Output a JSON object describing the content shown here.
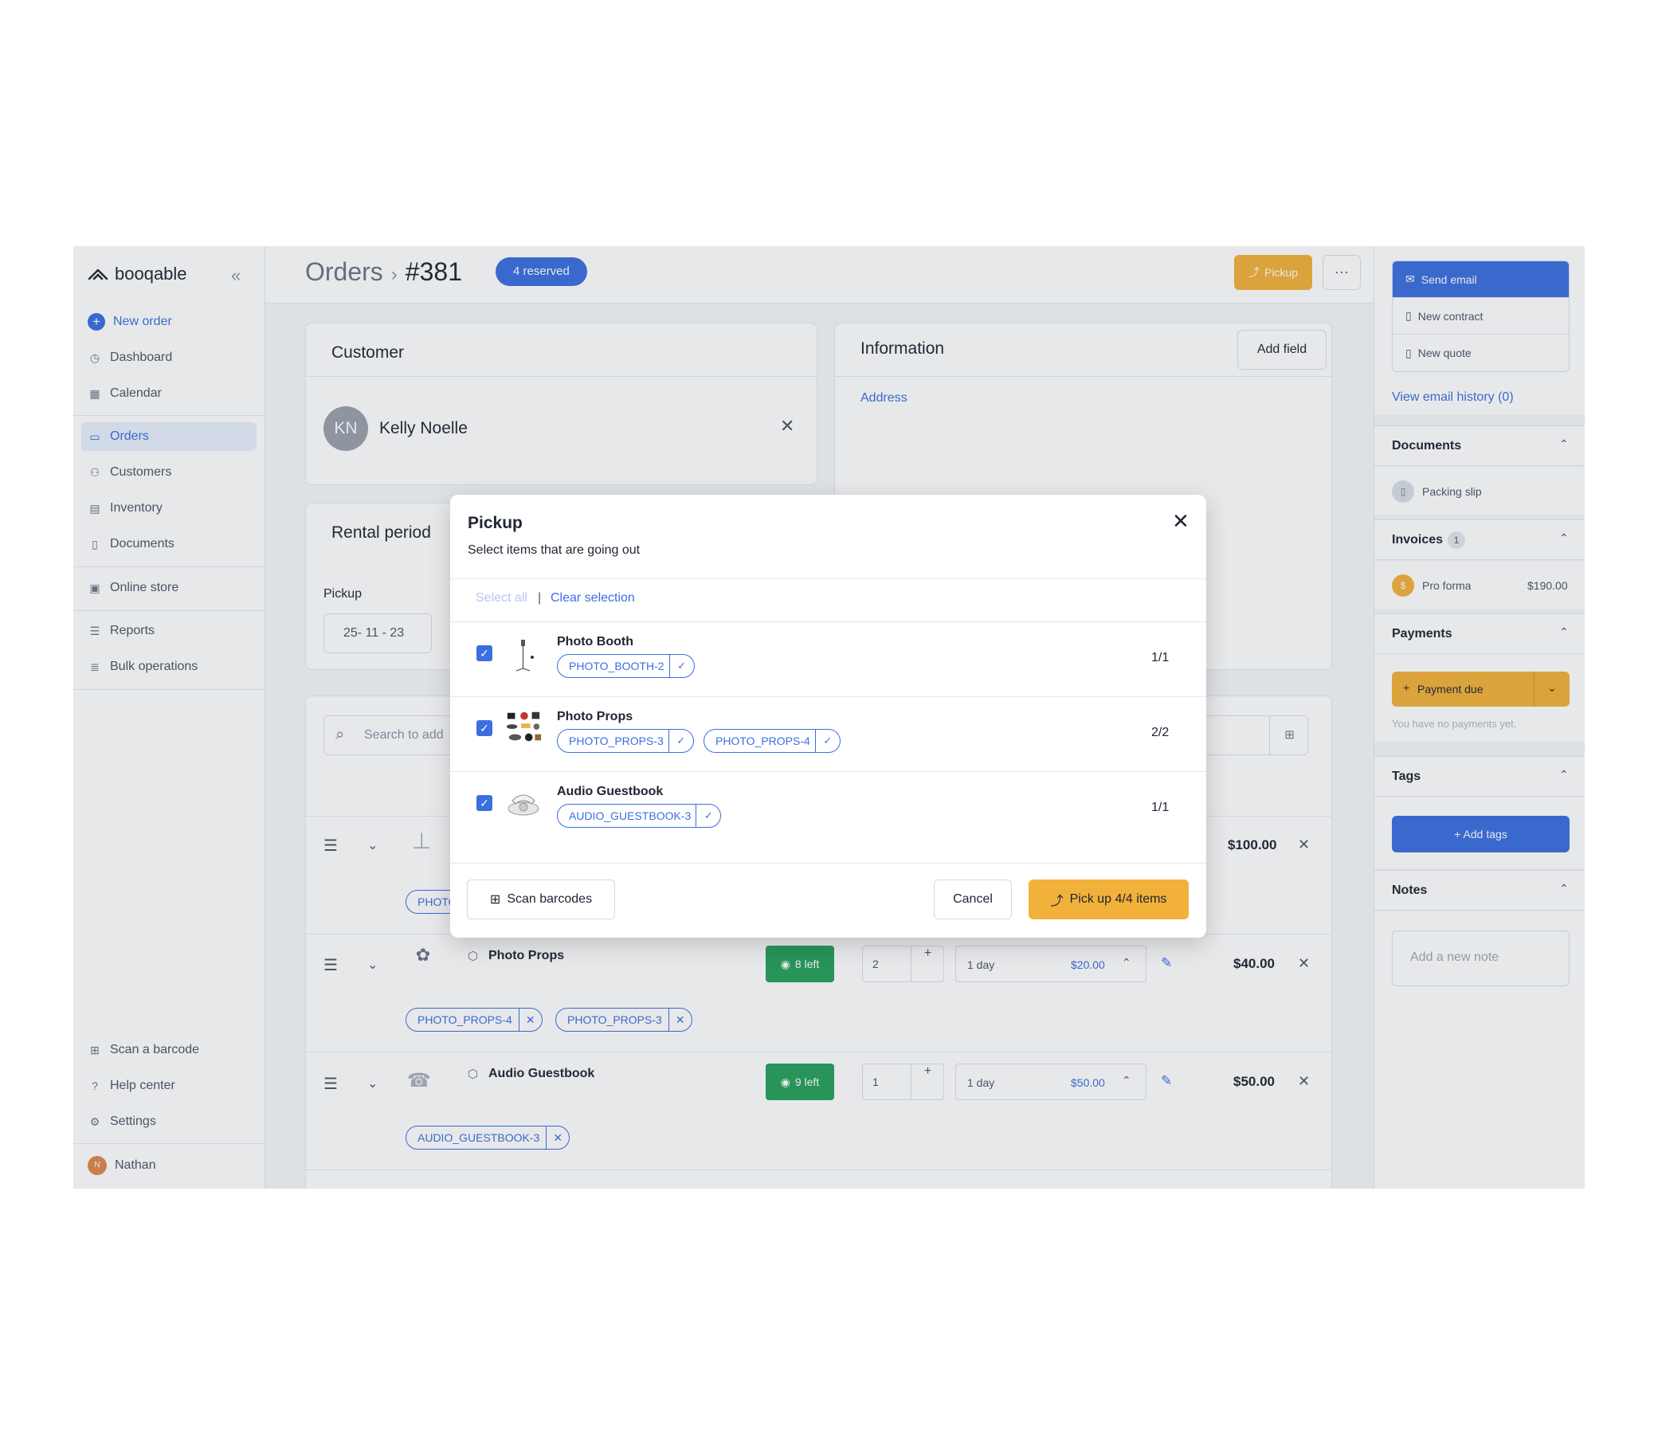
{
  "sidebar": {
    "brand": "booqable",
    "new_order": "New order",
    "items": [
      {
        "label": "Dashboard"
      },
      {
        "label": "Calendar"
      },
      {
        "label": "Orders"
      },
      {
        "label": "Customers"
      },
      {
        "label": "Inventory"
      },
      {
        "label": "Documents"
      },
      {
        "label": "Online store"
      },
      {
        "label": "Reports"
      },
      {
        "label": "Bulk operations"
      }
    ],
    "bottom": [
      {
        "label": "Scan a barcode"
      },
      {
        "label": "Help center"
      },
      {
        "label": "Settings"
      }
    ],
    "user": {
      "initial": "N",
      "name": "Nathan"
    }
  },
  "header": {
    "crumb_root": "Orders",
    "order_number": "#381",
    "status_badge": "4 reserved",
    "pickup_button": "Pickup",
    "more_button": "···"
  },
  "customer": {
    "title": "Customer",
    "initials": "KN",
    "name": "Kelly Noelle"
  },
  "information": {
    "title": "Information",
    "add_field": "Add field",
    "address_label": "Address"
  },
  "rental": {
    "title": "Rental period",
    "pickup_label": "Pickup",
    "pickup_date": "25- 11 - 23"
  },
  "search": {
    "placeholder": "Search to add"
  },
  "line_items": [
    {
      "name": "Photo Booth",
      "price": "$100.00",
      "tags": [
        "PHOTO"
      ]
    },
    {
      "name": "Photo Props",
      "stock": "8 left",
      "qty": "2",
      "duration": "1 day",
      "rate": "$20.00",
      "price": "$40.00",
      "tags": [
        "PHOTO_PROPS-4",
        "PHOTO_PROPS-3"
      ]
    },
    {
      "name": "Audio Guestbook",
      "stock": "9 left",
      "qty": "1",
      "duration": "1 day",
      "rate": "$50.00",
      "price": "$50.00",
      "tags": [
        "AUDIO_GUESTBOOK-3"
      ]
    }
  ],
  "right_panel": {
    "send_email": "Send email",
    "new_contract": "New contract",
    "new_quote": "New quote",
    "email_history": "View email history (0)",
    "documents_title": "Documents",
    "packing_slip": "Packing slip",
    "invoices_title": "Invoices",
    "invoices_count": "1",
    "pro_forma": "Pro forma",
    "pro_forma_amount": "$190.00",
    "payments_title": "Payments",
    "payment_due": "Payment due",
    "no_payments": "You have no payments yet.",
    "tags_title": "Tags",
    "add_tags": "Add tags",
    "notes_title": "Notes",
    "note_placeholder": "Add a new note"
  },
  "modal": {
    "title": "Pickup",
    "subtitle": "Select items that are going out",
    "select_all": "Select all",
    "separator": "|",
    "clear_selection": "Clear selection",
    "rows": [
      {
        "name": "Photo Booth",
        "tags": [
          "PHOTO_BOOTH-2"
        ],
        "qty": "1/1"
      },
      {
        "name": "Photo Props",
        "tags": [
          "PHOTO_PROPS-3",
          "PHOTO_PROPS-4"
        ],
        "qty": "2/2"
      },
      {
        "name": "Audio Guestbook",
        "tags": [
          "AUDIO_GUESTBOOK-3"
        ],
        "qty": "1/1"
      }
    ],
    "scan_barcodes": "Scan barcodes",
    "cancel": "Cancel",
    "confirm": "Pick up 4/4 items"
  },
  "colors": {
    "accent": "#3b6fe0",
    "pickup_orange": "#f2b13a",
    "stock_green": "#26a05a"
  }
}
